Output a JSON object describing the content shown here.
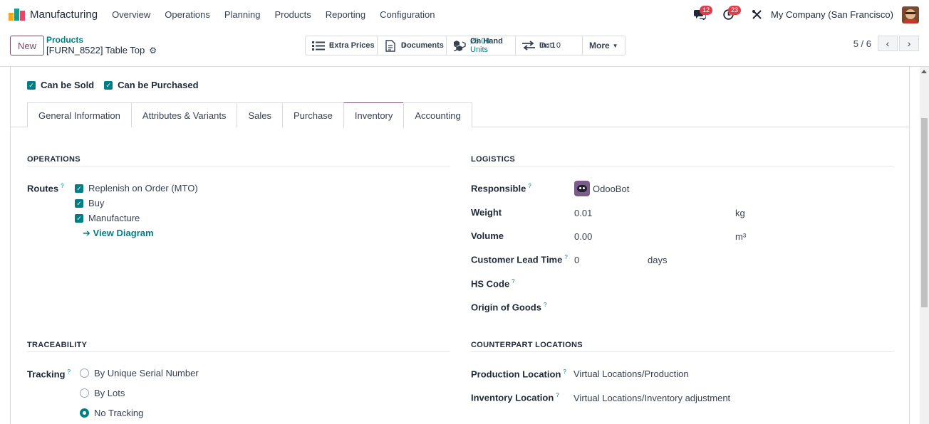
{
  "nav": {
    "app_name": "Manufacturing",
    "menu": [
      "Overview",
      "Operations",
      "Planning",
      "Products",
      "Reporting",
      "Configuration"
    ],
    "messages_badge": "12",
    "activities_badge": "23",
    "company": "My Company (San Francisco)"
  },
  "control": {
    "new_label": "New",
    "breadcrumb_parent": "Products",
    "record_title": "[FURN_8522] Table Top",
    "smart_buttons": [
      {
        "label": "Extra Prices",
        "value": "0"
      },
      {
        "label": "Documents",
        "value": "0"
      },
      {
        "label": "On Hand",
        "value": "25.00 Units"
      },
      {
        "label": "In: 1",
        "value": "Out: 0"
      }
    ],
    "more_label": "More",
    "pager": "5 / 6"
  },
  "form": {
    "can_be_sold": "Can be Sold",
    "can_be_purchased": "Can be Purchased",
    "tabs": [
      "General Information",
      "Attributes & Variants",
      "Sales",
      "Purchase",
      "Inventory",
      "Accounting"
    ],
    "active_tab": "Inventory",
    "operations": {
      "title": "OPERATIONS",
      "routes_label": "Routes",
      "routes": [
        "Replenish on Order (MTO)",
        "Buy",
        "Manufacture"
      ],
      "view_diagram": "View Diagram"
    },
    "logistics": {
      "title": "LOGISTICS",
      "responsible_label": "Responsible",
      "responsible_value": "OdooBot",
      "weight_label": "Weight",
      "weight_value": "0.01",
      "weight_unit": "kg",
      "volume_label": "Volume",
      "volume_value": "0.00",
      "volume_unit": "m³",
      "lead_label": "Customer Lead Time",
      "lead_value": "0",
      "lead_unit": "days",
      "hs_label": "HS Code",
      "origin_label": "Origin of Goods"
    },
    "traceability": {
      "title": "TRACEABILITY",
      "tracking_label": "Tracking",
      "options": [
        "By Unique Serial Number",
        "By Lots",
        "No Tracking"
      ],
      "selected": "No Tracking"
    },
    "counterpart": {
      "title": "COUNTERPART LOCATIONS",
      "production_label": "Production Location",
      "production_value": "Virtual Locations/Production",
      "inventory_label": "Inventory Location",
      "inventory_value": "Virtual Locations/Inventory adjustment"
    },
    "help_mark": "?"
  }
}
